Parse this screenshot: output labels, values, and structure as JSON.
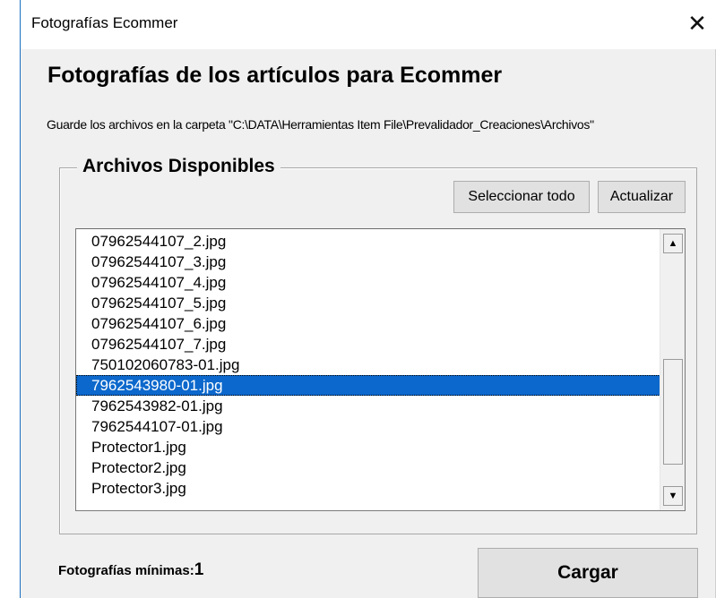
{
  "window": {
    "title": "Fotografías Ecommer",
    "close_symbol": "✕"
  },
  "heading": "Fotografías de los artículos para Ecommer",
  "path_note": "Guarde los archivos en la carpeta \"C:\\DATA\\Herramientas Item File\\Prevalidador_Creaciones\\Archivos\"",
  "group": {
    "legend": "Archivos Disponibles",
    "select_all_label": "Seleccionar todo",
    "refresh_label": "Actualizar",
    "files": [
      "07962544107_2.jpg",
      "07962544107_3.jpg",
      "07962544107_4.jpg",
      "07962544107_5.jpg",
      "07962544107_6.jpg",
      "07962544107_7.jpg",
      "750102060783-01.jpg",
      "7962543980-01.jpg",
      "7962543982-01.jpg",
      "7962544107-01.jpg",
      "Protector1.jpg",
      "Protector2.jpg",
      "Protector3.jpg"
    ],
    "selected_index": 7,
    "scroll_up_symbol": "▲",
    "scroll_down_symbol": "▼"
  },
  "footer": {
    "min_photos_label": "Fotografías mínimas:",
    "min_photos_value": "1",
    "load_label": "Cargar"
  },
  "colors": {
    "selection": "#0c68cc",
    "window_bg": "#f0f0f0",
    "button_bg": "#e1e1e1"
  }
}
